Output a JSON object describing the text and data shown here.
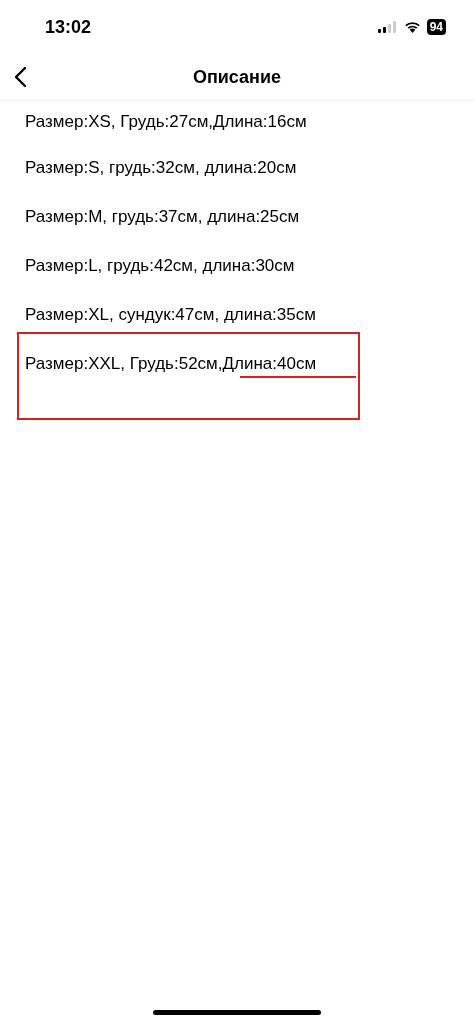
{
  "status_bar": {
    "time": "13:02",
    "battery": "94"
  },
  "header": {
    "title": "Описание"
  },
  "lines": [
    "Размер:XS, Грудь:27см,Длина:16см",
    "Размер:S, грудь:32см, длина:20см",
    "Размер:M, грудь:37см, длина:25см",
    "Размер:L, грудь:42см, длина:30см",
    "Размер:XL, сундук:47см, длина:35см",
    "Размер:XXL, Грудь:52см,Длина:40см"
  ]
}
